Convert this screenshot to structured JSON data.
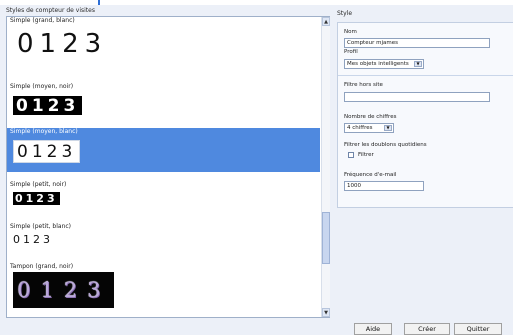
{
  "left_panel": {
    "title": "Styles de compteur de visites",
    "items": [
      {
        "label": "Simple (grand, blanc)",
        "digits": "0123"
      },
      {
        "label": "Simple (moyen, noir)",
        "digits": "0123"
      },
      {
        "label": "Simple (moyen, blanc)",
        "digits": "0123"
      },
      {
        "label": "Simple (petit, noir)",
        "digits": "0123"
      },
      {
        "label": "Simple (petit, blanc)",
        "digits": "0123"
      },
      {
        "label": "Tampon (grand, noir)",
        "digits": "0123"
      }
    ]
  },
  "style_panel": {
    "title": "Style",
    "nom_label": "Nom",
    "nom_value": "Compteur mjames",
    "profil_label": "Profil",
    "profil_value": "Mes objets intelligents",
    "filtre_label": "Filtre hors site",
    "filtre_value": "",
    "chiffres_label": "Nombre de chiffres",
    "chiffres_value": "4 chiffres",
    "doublons_label": "Filtrer les doublons quotidiens",
    "filtrer_label": "Filtrer",
    "email_label": "Fréquence d'e-mail",
    "email_value": "1000"
  },
  "buttons": {
    "aide": "Aide",
    "creer": "Créer",
    "quitter": "Quitter"
  },
  "icons": {
    "scroll_up": "scroll-up-arrow-icon",
    "scroll_down": "scroll-down-arrow-icon",
    "dropdown": "chevron-down-icon"
  },
  "colors": {
    "selection": "#4f89df",
    "panel_border": "#9fb0c9"
  }
}
